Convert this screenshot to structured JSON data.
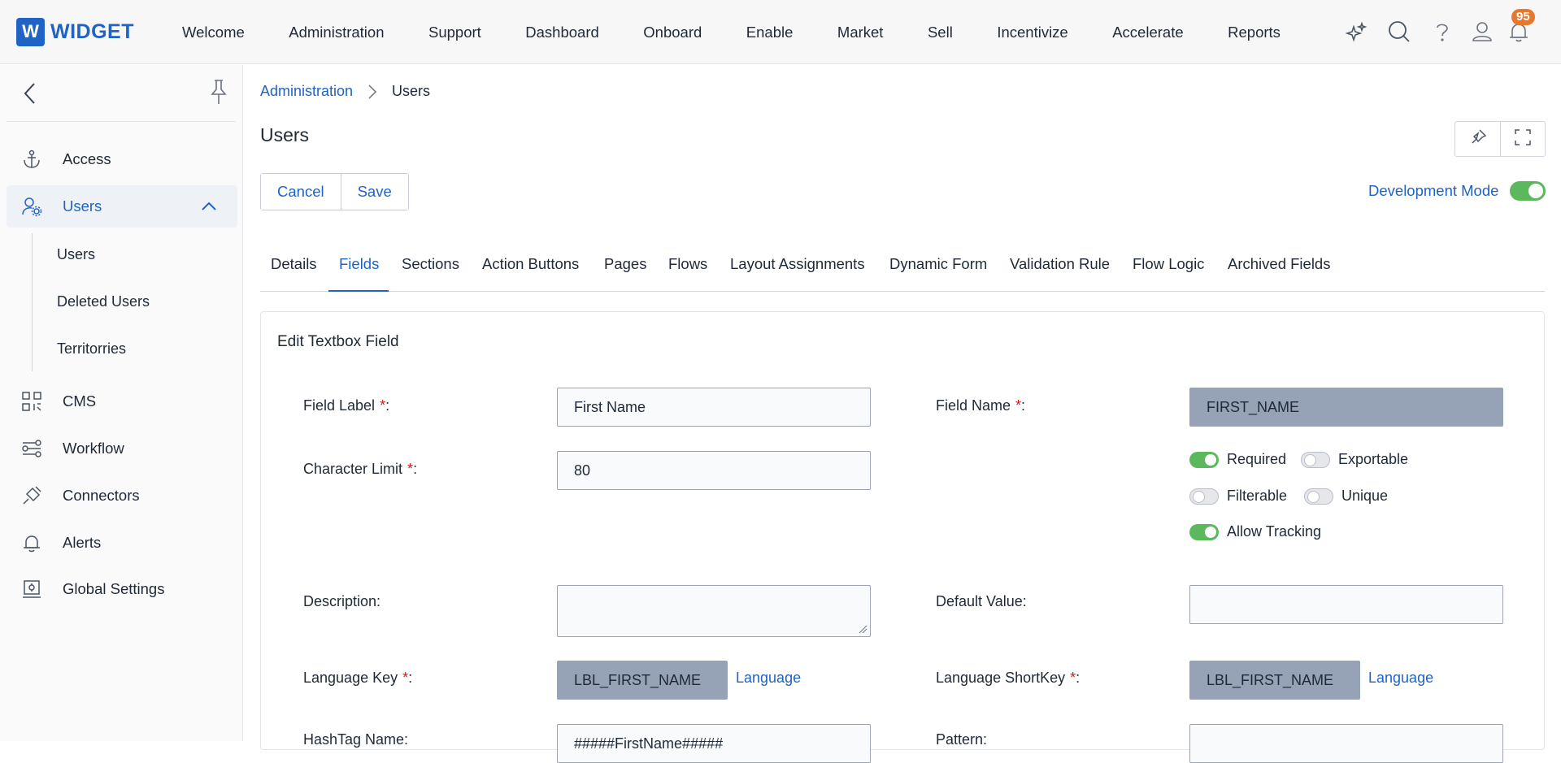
{
  "brand": {
    "logo_letter": "W",
    "name": "WIDGET",
    "color": "#1f63c4"
  },
  "topnav": {
    "items": [
      "Welcome",
      "Administration",
      "Support",
      "Dashboard",
      "Onboard",
      "Enable",
      "Market",
      "Sell",
      "Incentivize",
      "Accelerate",
      "Reports"
    ],
    "icons": [
      "sparkle-icon",
      "search-icon",
      "help-icon",
      "user-icon",
      "bell-icon"
    ],
    "notification_count": "95"
  },
  "sidebar": {
    "items": [
      {
        "label": "Access",
        "icon": "anchor-icon"
      },
      {
        "label": "Users",
        "icon": "users-gear-icon",
        "active": true
      },
      {
        "label": "CMS",
        "icon": "qr-code-icon"
      },
      {
        "label": "Workflow",
        "icon": "workflow-icon"
      },
      {
        "label": "Connectors",
        "icon": "plug-icon"
      },
      {
        "label": "Alerts",
        "icon": "bell-icon"
      },
      {
        "label": "Global Settings",
        "icon": "settings-screen-icon"
      }
    ],
    "subitems": [
      "Users",
      "Deleted Users",
      "Territorries"
    ]
  },
  "breadcrumb": {
    "parent": "Administration",
    "current": "Users"
  },
  "page": {
    "title": "Users"
  },
  "actions": {
    "cancel": "Cancel",
    "save": "Save"
  },
  "dev_mode": {
    "label": "Development Mode",
    "enabled": true
  },
  "tabs": [
    "Details",
    "Fields",
    "Sections",
    "Action Buttons",
    "Pages",
    "Flows",
    "Layout Assignments",
    "Dynamic Form",
    "Validation Rule",
    "Flow Logic",
    "Archived Fields"
  ],
  "active_tab": "Fields",
  "form": {
    "title": "Edit Textbox Field",
    "field_label": {
      "label": "Field Label",
      "value": "First Name"
    },
    "field_name": {
      "label": "Field Name",
      "value": "FIRST_NAME"
    },
    "character_limit": {
      "label": "Character Limit",
      "value": "80"
    },
    "switches": {
      "required": {
        "label": "Required",
        "on": true
      },
      "exportable": {
        "label": "Exportable",
        "on": false
      },
      "filterable": {
        "label": "Filterable",
        "on": false
      },
      "unique": {
        "label": "Unique",
        "on": false
      },
      "allow_tracking": {
        "label": "Allow Tracking",
        "on": true
      }
    },
    "description": {
      "label": "Description:",
      "value": ""
    },
    "default_value": {
      "label": "Default Value:",
      "value": ""
    },
    "language_key": {
      "label": "Language Key",
      "value": "LBL_FIRST_NAME",
      "link": "Language"
    },
    "language_shortkey": {
      "label": "Language ShortKey",
      "value": "LBL_FIRST_NAME",
      "link": "Language"
    },
    "hashtag_name": {
      "label": "HashTag Name:",
      "value": "#####FirstName#####"
    },
    "pattern": {
      "label": "Pattern:",
      "value": ""
    }
  }
}
